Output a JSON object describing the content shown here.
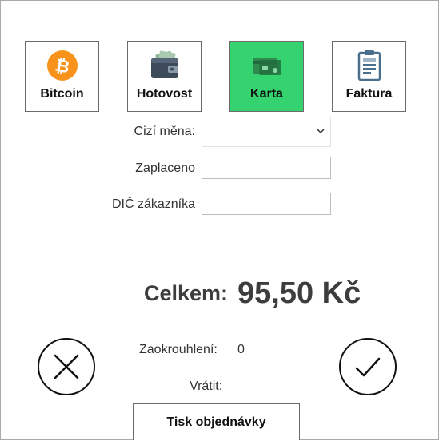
{
  "payment_methods": [
    {
      "label": "Bitcoin",
      "icon": "bitcoin-icon",
      "active": false
    },
    {
      "label": "Hotovost",
      "icon": "wallet-icon",
      "active": false
    },
    {
      "label": "Karta",
      "icon": "credit-card-icon",
      "active": true
    },
    {
      "label": "Faktura",
      "icon": "invoice-clipboard-icon",
      "active": false
    }
  ],
  "form": {
    "currency_label": "Cizí měna:",
    "currency_value": "",
    "paid_label": "Zaplaceno",
    "paid_value": "",
    "tax_id_label": "DIČ zákazníka",
    "tax_id_value": ""
  },
  "summary": {
    "total_label": "Celkem:",
    "total_value": "95,50 Kč",
    "rounding_label": "Zaokrouhlení:",
    "rounding_value": "0",
    "change_label": "Vrátit:"
  },
  "actions": {
    "cancel_icon": "close-icon",
    "confirm_icon": "checkmark-icon",
    "print_label": "Tisk objednávky"
  },
  "colors": {
    "active_method": "#34d36f",
    "bitcoin": "#f7931a",
    "wallet": "#3c4a5a",
    "card": "#2f8a4f",
    "invoice": "#4a6f8c"
  }
}
